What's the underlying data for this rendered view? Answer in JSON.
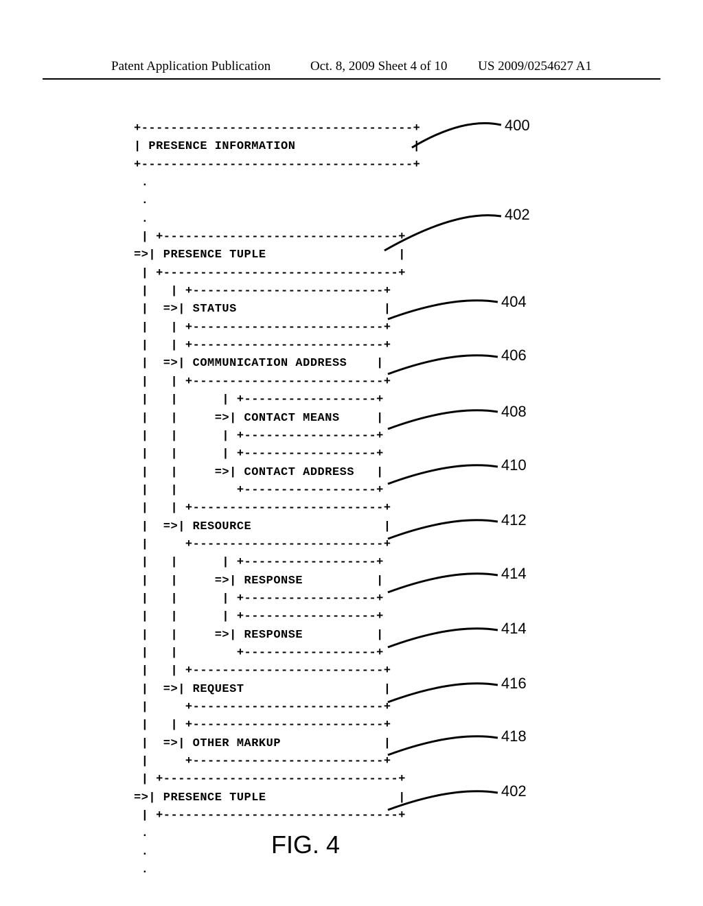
{
  "header": {
    "left": "Patent Application Publication",
    "center": "Oct. 8, 2009  Sheet 4 of 10",
    "right": "US 2009/0254627 A1"
  },
  "diagram": {
    "lines": [
      "+-------------------------------------+",
      "| PRESENCE INFORMATION                |",
      "+-------------------------------------+",
      " .",
      " .",
      " .",
      " | +--------------------------------+",
      "=>| PRESENCE TUPLE                  |",
      " | +--------------------------------+",
      " |   | +--------------------------+",
      " |  =>| STATUS                    |",
      " |   | +--------------------------+",
      " |   | +--------------------------+",
      " |  =>| COMMUNICATION ADDRESS    |",
      " |   | +--------------------------+",
      " |   |      | +------------------+",
      " |   |     =>| CONTACT MEANS     |",
      " |   |      | +------------------+",
      " |   |      | +------------------+",
      " |   |     =>| CONTACT ADDRESS   |",
      " |   |        +------------------+",
      " |   | +--------------------------+",
      " |  =>| RESOURCE                  |",
      " |     +--------------------------+",
      " |   |      | +------------------+",
      " |   |     =>| RESPONSE          |",
      " |   |      | +------------------+",
      " |   |      | +------------------+",
      " |   |     =>| RESPONSE          |",
      " |   |        +------------------+",
      " |   | +--------------------------+",
      " |  =>| REQUEST                   |",
      " |     +--------------------------+",
      " |   | +--------------------------+",
      " |  =>| OTHER MARKUP              |",
      " |     +--------------------------+",
      " | +--------------------------------+",
      "=>| PRESENCE TUPLE                  |",
      " | +--------------------------------+",
      " .",
      " .",
      " ."
    ]
  },
  "callouts": {
    "c400": "400",
    "c402a": "402",
    "c404": "404",
    "c406": "406",
    "c408": "408",
    "c410": "410",
    "c412": "412",
    "c414a": "414",
    "c414b": "414",
    "c416": "416",
    "c418": "418",
    "c402b": "402"
  },
  "figure_label": "FIG. 4"
}
